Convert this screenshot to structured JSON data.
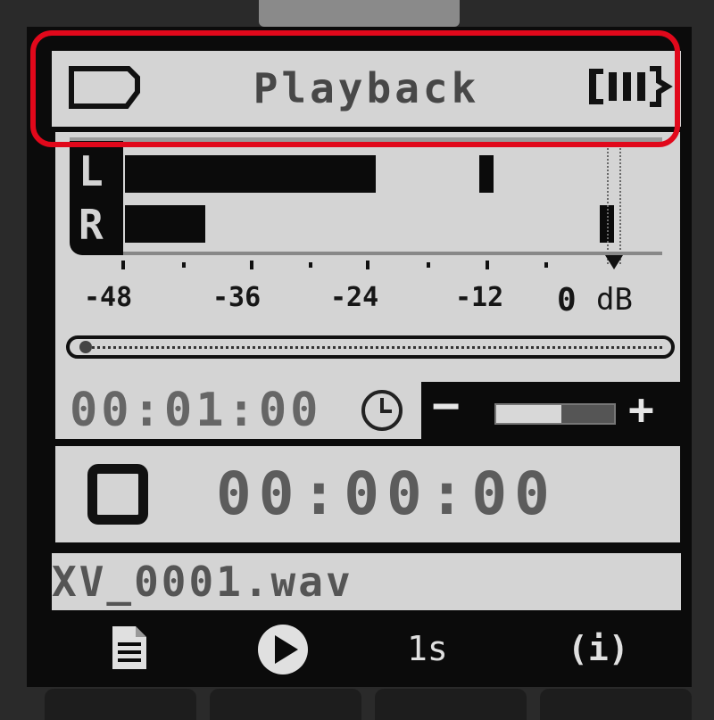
{
  "header": {
    "title": "Playback",
    "storage_icon": "sd-card-icon",
    "battery_icon": "battery-full-icon"
  },
  "meter": {
    "channels": [
      {
        "label": "L",
        "level_db": -23,
        "peak_db": -12
      },
      {
        "label": "R",
        "level_db": -40,
        "peak_db": 0
      }
    ],
    "scale": [
      "-48",
      "-36",
      "-24",
      "-12",
      "0",
      "dB"
    ]
  },
  "position": {
    "progress": 0.01
  },
  "clock": {
    "time": "00:01:00",
    "icon": "clock-icon"
  },
  "volume": {
    "minus": "−",
    "plus": "+",
    "level": 0.55
  },
  "transport": {
    "state_icon": "stop-icon",
    "time": "00:00:00"
  },
  "file": {
    "name": "XV_0001.wav"
  },
  "softkeys": {
    "file_icon": "document-icon",
    "play_icon": "play-icon",
    "interval": "1s",
    "info": "(i)"
  },
  "colors": {
    "screen_bg": "#d4d4d4",
    "bar": "#0b0b0b",
    "highlight": "#e1081b",
    "text_dim": "#5c5c5c"
  }
}
